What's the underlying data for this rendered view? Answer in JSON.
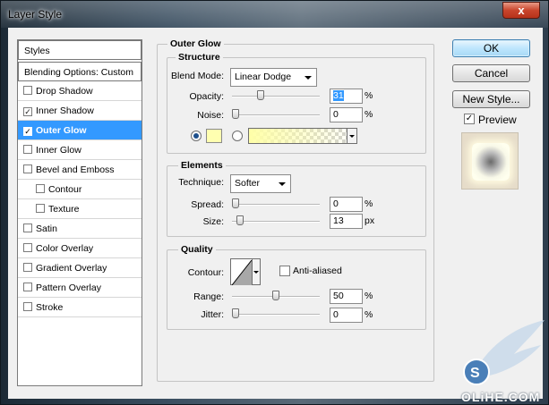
{
  "window": {
    "title": "Layer Style",
    "close_label": "x"
  },
  "styles_list": {
    "header": "Styles",
    "blending": "Blending Options: Custom",
    "items": [
      {
        "label": "Drop Shadow",
        "checked": false,
        "selected": false,
        "indent": false
      },
      {
        "label": "Inner Shadow",
        "checked": true,
        "selected": false,
        "indent": false
      },
      {
        "label": "Outer Glow",
        "checked": true,
        "selected": true,
        "indent": false
      },
      {
        "label": "Inner Glow",
        "checked": false,
        "selected": false,
        "indent": false
      },
      {
        "label": "Bevel and Emboss",
        "checked": false,
        "selected": false,
        "indent": false
      },
      {
        "label": "Contour",
        "checked": false,
        "selected": false,
        "indent": true
      },
      {
        "label": "Texture",
        "checked": false,
        "selected": false,
        "indent": true
      },
      {
        "label": "Satin",
        "checked": false,
        "selected": false,
        "indent": false
      },
      {
        "label": "Color Overlay",
        "checked": false,
        "selected": false,
        "indent": false
      },
      {
        "label": "Gradient Overlay",
        "checked": false,
        "selected": false,
        "indent": false
      },
      {
        "label": "Pattern Overlay",
        "checked": false,
        "selected": false,
        "indent": false
      },
      {
        "label": "Stroke",
        "checked": false,
        "selected": false,
        "indent": false
      }
    ]
  },
  "panel": {
    "title": "Outer Glow",
    "structure": {
      "legend": "Structure",
      "blend_mode_label": "Blend Mode:",
      "blend_mode_value": "Linear Dodge",
      "opacity_label": "Opacity:",
      "opacity_value": "31",
      "opacity_fraction": 0.31,
      "opacity_unit": "%",
      "noise_label": "Noise:",
      "noise_value": "0",
      "noise_fraction": 0,
      "noise_unit": "%",
      "glow_color": "#ffffb0"
    },
    "elements": {
      "legend": "Elements",
      "technique_label": "Technique:",
      "technique_value": "Softer",
      "spread_label": "Spread:",
      "spread_value": "0",
      "spread_fraction": 0,
      "spread_unit": "%",
      "size_label": "Size:",
      "size_value": "13",
      "size_fraction": 0.052,
      "size_unit": "px"
    },
    "quality": {
      "legend": "Quality",
      "contour_label": "Contour:",
      "anti_aliased_label": "Anti-aliased",
      "anti_aliased": false,
      "range_label": "Range:",
      "range_value": "50",
      "range_fraction": 0.5,
      "range_unit": "%",
      "jitter_label": "Jitter:",
      "jitter_value": "0",
      "jitter_fraction": 0,
      "jitter_unit": "%"
    }
  },
  "buttons": {
    "ok": "OK",
    "cancel": "Cancel",
    "new_style": "New Style...",
    "preview_label": "Preview",
    "preview_checked": true
  },
  "watermark": {
    "text": "OLiHE.COM"
  },
  "colors": {
    "selection": "#3399ff",
    "ok_button": "#bee6fd"
  }
}
